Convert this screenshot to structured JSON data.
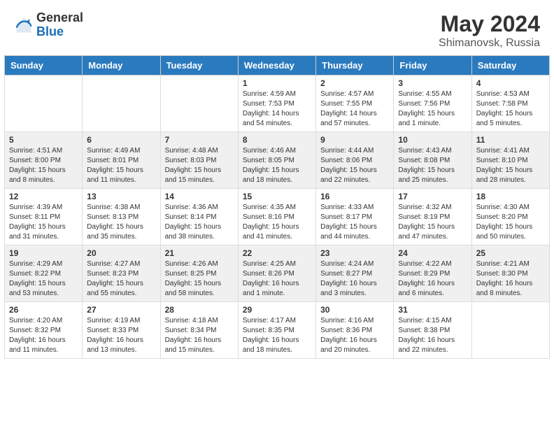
{
  "header": {
    "logo_general": "General",
    "logo_blue": "Blue",
    "month_title": "May 2024",
    "location": "Shimanovsk, Russia"
  },
  "days_of_week": [
    "Sunday",
    "Monday",
    "Tuesday",
    "Wednesday",
    "Thursday",
    "Friday",
    "Saturday"
  ],
  "weeks": [
    {
      "days": [
        {
          "number": "",
          "sunrise": "",
          "sunset": "",
          "daylight": ""
        },
        {
          "number": "",
          "sunrise": "",
          "sunset": "",
          "daylight": ""
        },
        {
          "number": "",
          "sunrise": "",
          "sunset": "",
          "daylight": ""
        },
        {
          "number": "1",
          "sunrise": "Sunrise: 4:59 AM",
          "sunset": "Sunset: 7:53 PM",
          "daylight": "Daylight: 14 hours and 54 minutes."
        },
        {
          "number": "2",
          "sunrise": "Sunrise: 4:57 AM",
          "sunset": "Sunset: 7:55 PM",
          "daylight": "Daylight: 14 hours and 57 minutes."
        },
        {
          "number": "3",
          "sunrise": "Sunrise: 4:55 AM",
          "sunset": "Sunset: 7:56 PM",
          "daylight": "Daylight: 15 hours and 1 minute."
        },
        {
          "number": "4",
          "sunrise": "Sunrise: 4:53 AM",
          "sunset": "Sunset: 7:58 PM",
          "daylight": "Daylight: 15 hours and 5 minutes."
        }
      ]
    },
    {
      "days": [
        {
          "number": "5",
          "sunrise": "Sunrise: 4:51 AM",
          "sunset": "Sunset: 8:00 PM",
          "daylight": "Daylight: 15 hours and 8 minutes."
        },
        {
          "number": "6",
          "sunrise": "Sunrise: 4:49 AM",
          "sunset": "Sunset: 8:01 PM",
          "daylight": "Daylight: 15 hours and 11 minutes."
        },
        {
          "number": "7",
          "sunrise": "Sunrise: 4:48 AM",
          "sunset": "Sunset: 8:03 PM",
          "daylight": "Daylight: 15 hours and 15 minutes."
        },
        {
          "number": "8",
          "sunrise": "Sunrise: 4:46 AM",
          "sunset": "Sunset: 8:05 PM",
          "daylight": "Daylight: 15 hours and 18 minutes."
        },
        {
          "number": "9",
          "sunrise": "Sunrise: 4:44 AM",
          "sunset": "Sunset: 8:06 PM",
          "daylight": "Daylight: 15 hours and 22 minutes."
        },
        {
          "number": "10",
          "sunrise": "Sunrise: 4:43 AM",
          "sunset": "Sunset: 8:08 PM",
          "daylight": "Daylight: 15 hours and 25 minutes."
        },
        {
          "number": "11",
          "sunrise": "Sunrise: 4:41 AM",
          "sunset": "Sunset: 8:10 PM",
          "daylight": "Daylight: 15 hours and 28 minutes."
        }
      ]
    },
    {
      "days": [
        {
          "number": "12",
          "sunrise": "Sunrise: 4:39 AM",
          "sunset": "Sunset: 8:11 PM",
          "daylight": "Daylight: 15 hours and 31 minutes."
        },
        {
          "number": "13",
          "sunrise": "Sunrise: 4:38 AM",
          "sunset": "Sunset: 8:13 PM",
          "daylight": "Daylight: 15 hours and 35 minutes."
        },
        {
          "number": "14",
          "sunrise": "Sunrise: 4:36 AM",
          "sunset": "Sunset: 8:14 PM",
          "daylight": "Daylight: 15 hours and 38 minutes."
        },
        {
          "number": "15",
          "sunrise": "Sunrise: 4:35 AM",
          "sunset": "Sunset: 8:16 PM",
          "daylight": "Daylight: 15 hours and 41 minutes."
        },
        {
          "number": "16",
          "sunrise": "Sunrise: 4:33 AM",
          "sunset": "Sunset: 8:17 PM",
          "daylight": "Daylight: 15 hours and 44 minutes."
        },
        {
          "number": "17",
          "sunrise": "Sunrise: 4:32 AM",
          "sunset": "Sunset: 8:19 PM",
          "daylight": "Daylight: 15 hours and 47 minutes."
        },
        {
          "number": "18",
          "sunrise": "Sunrise: 4:30 AM",
          "sunset": "Sunset: 8:20 PM",
          "daylight": "Daylight: 15 hours and 50 minutes."
        }
      ]
    },
    {
      "days": [
        {
          "number": "19",
          "sunrise": "Sunrise: 4:29 AM",
          "sunset": "Sunset: 8:22 PM",
          "daylight": "Daylight: 15 hours and 53 minutes."
        },
        {
          "number": "20",
          "sunrise": "Sunrise: 4:27 AM",
          "sunset": "Sunset: 8:23 PM",
          "daylight": "Daylight: 15 hours and 55 minutes."
        },
        {
          "number": "21",
          "sunrise": "Sunrise: 4:26 AM",
          "sunset": "Sunset: 8:25 PM",
          "daylight": "Daylight: 15 hours and 58 minutes."
        },
        {
          "number": "22",
          "sunrise": "Sunrise: 4:25 AM",
          "sunset": "Sunset: 8:26 PM",
          "daylight": "Daylight: 16 hours and 1 minute."
        },
        {
          "number": "23",
          "sunrise": "Sunrise: 4:24 AM",
          "sunset": "Sunset: 8:27 PM",
          "daylight": "Daylight: 16 hours and 3 minutes."
        },
        {
          "number": "24",
          "sunrise": "Sunrise: 4:22 AM",
          "sunset": "Sunset: 8:29 PM",
          "daylight": "Daylight: 16 hours and 6 minutes."
        },
        {
          "number": "25",
          "sunrise": "Sunrise: 4:21 AM",
          "sunset": "Sunset: 8:30 PM",
          "daylight": "Daylight: 16 hours and 8 minutes."
        }
      ]
    },
    {
      "days": [
        {
          "number": "26",
          "sunrise": "Sunrise: 4:20 AM",
          "sunset": "Sunset: 8:32 PM",
          "daylight": "Daylight: 16 hours and 11 minutes."
        },
        {
          "number": "27",
          "sunrise": "Sunrise: 4:19 AM",
          "sunset": "Sunset: 8:33 PM",
          "daylight": "Daylight: 16 hours and 13 minutes."
        },
        {
          "number": "28",
          "sunrise": "Sunrise: 4:18 AM",
          "sunset": "Sunset: 8:34 PM",
          "daylight": "Daylight: 16 hours and 15 minutes."
        },
        {
          "number": "29",
          "sunrise": "Sunrise: 4:17 AM",
          "sunset": "Sunset: 8:35 PM",
          "daylight": "Daylight: 16 hours and 18 minutes."
        },
        {
          "number": "30",
          "sunrise": "Sunrise: 4:16 AM",
          "sunset": "Sunset: 8:36 PM",
          "daylight": "Daylight: 16 hours and 20 minutes."
        },
        {
          "number": "31",
          "sunrise": "Sunrise: 4:15 AM",
          "sunset": "Sunset: 8:38 PM",
          "daylight": "Daylight: 16 hours and 22 minutes."
        },
        {
          "number": "",
          "sunrise": "",
          "sunset": "",
          "daylight": ""
        }
      ]
    }
  ]
}
